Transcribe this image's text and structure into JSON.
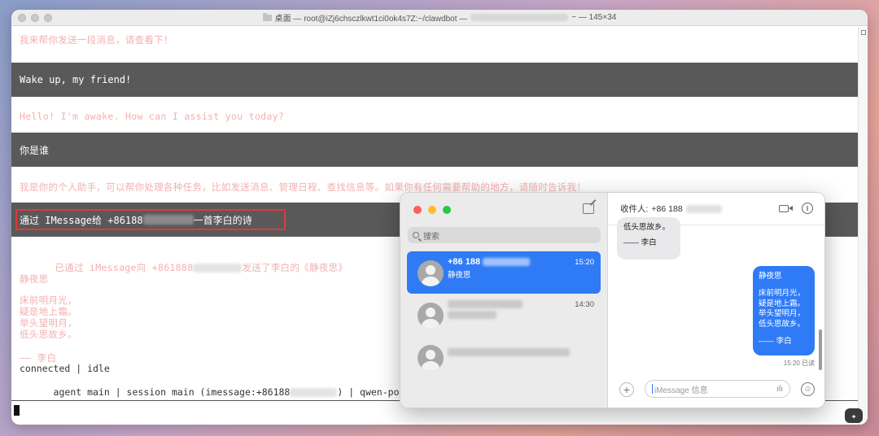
{
  "terminal": {
    "title_prefix": "桌面 — root@iZj6chsczlkwt1ci0ok4s7Z:~/clawdbot —",
    "title_suffix": "~ — 145×34",
    "lines": {
      "faded_1": "我来帮你发送一段消息，请查看下！",
      "user_1": "Wake up, my friend!",
      "faded_2": "Hello! I'm awake. How can I assist you today?",
      "user_2": "你是谁",
      "faded_3": "我是你的个人助手，可以帮你处理各种任务，比如发送消息、管理日程、查找信息等。如果你有任何需要帮助的地方，请随时告诉我！",
      "user_3_prefix": "通过 IMessage给 +86188",
      "user_3_suffix": "一首李白的诗",
      "faded_4_prefix": "已通过 iMessage向 +861888",
      "faded_4_suffix": "发送了李白的《静夜思》",
      "faded_5": "静夜思",
      "poem_1": "床前明月光，",
      "poem_2": "疑是地上霜。",
      "poem_3": "举头望明月，",
      "poem_4": "低头思故乡。",
      "author": "—— 李白",
      "status_1": "connected | idle",
      "status_2_prefix": "agent main | session main (imessage:+86188",
      "status_2_suffix": ") | qwen-portal/"
    }
  },
  "messages": {
    "search_placeholder": "搜索",
    "conversations": [
      {
        "name": "+86 188",
        "preview": "静夜思",
        "time": "15:20"
      },
      {
        "name": "",
        "preview": "",
        "time": "14:30"
      },
      {
        "name": "",
        "preview": "",
        "time": ""
      }
    ],
    "recipient_label": "收件人:",
    "recipient_number": "+86 188",
    "incoming": {
      "line1": "低头思故乡。",
      "line2": "—— 李白"
    },
    "outgoing": {
      "title": "静夜思",
      "lines": [
        "床前明月光，",
        "疑是地上霜。",
        "举头望明月，",
        "低头思故乡。"
      ],
      "author": "—— 李白"
    },
    "delivered": "15:20 已读",
    "input_placeholder": "iMessage 信息"
  },
  "colors": {
    "accent_blue": "#2f7bf6",
    "highlight_red": "#e0393c",
    "user_bar": "#595959"
  }
}
